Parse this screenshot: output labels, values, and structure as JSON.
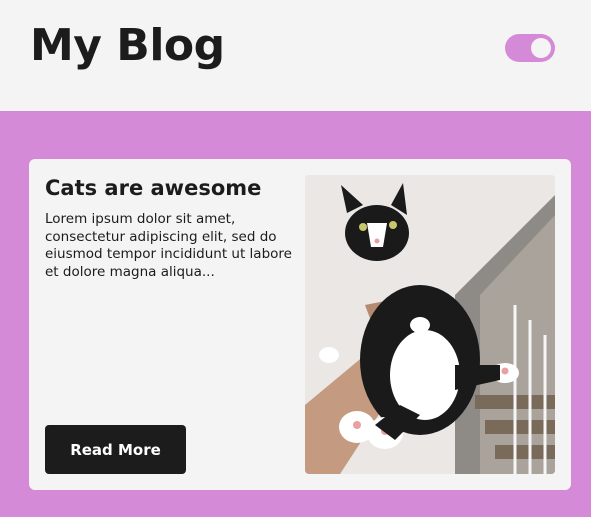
{
  "header": {
    "title": "My Blog",
    "theme_toggle_on": true
  },
  "post": {
    "title": "Cats are awesome",
    "excerpt": "Lorem ipsum dolor sit amet, consectetur adipiscing elit, sed do eiusmod tempor incididunt ut labore et dolore magna aliqua...",
    "read_more_label": "Read More",
    "image_subject": "black-and-white-cat"
  },
  "colors": {
    "accent": "#d58ad7",
    "background": "#f4f4f4",
    "text": "#1c1c1c",
    "button": "#1c1c1c"
  }
}
